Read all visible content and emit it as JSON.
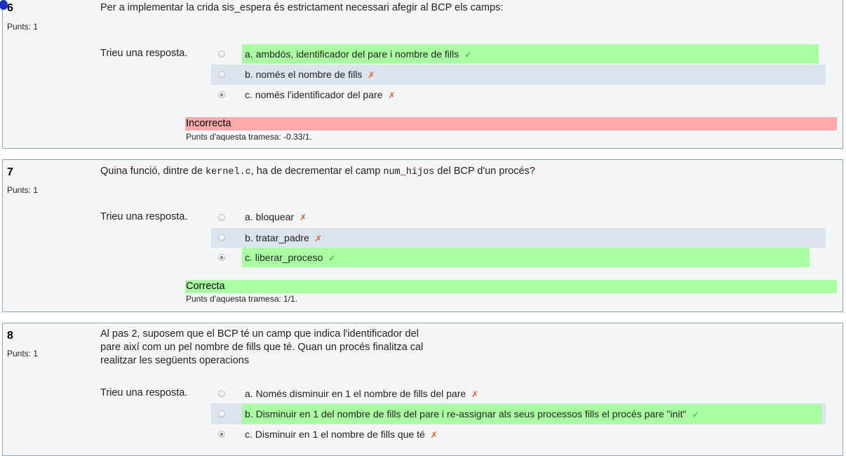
{
  "questions": [
    {
      "number": "6",
      "points": "Punts: 1",
      "text": "Per a implementar la crida sis_espera és estrictament necessari afegir al BCP els camps:",
      "prompt": "Trieu una resposta.",
      "options": [
        {
          "label": "a. ambdós, identificador del pare i nombre de fills",
          "mark": "✓"
        },
        {
          "label": "b. només el nombre de fills",
          "mark": "✗"
        },
        {
          "label": "c. només l'identificador del pare",
          "mark": "✗"
        }
      ],
      "selected": "c",
      "verdict": "Incorrecta",
      "grade": "Punts d'aquesta tramesa: -0.33/1."
    },
    {
      "number": "7",
      "points": "Punts: 1",
      "text_before": "Quina funció, dintre de ",
      "text_code1": "kernel.c",
      "text_middle": ", ha de decrementar el camp ",
      "text_code2": "num_hijos",
      "text_after": " del BCP d'un procés?",
      "prompt": "Trieu una resposta.",
      "options": [
        {
          "label": "a. bloquear",
          "mark": "✗"
        },
        {
          "label": "b. tratar_padre",
          "mark": "✗"
        },
        {
          "label": "c. liberar_proceso",
          "mark": "✓"
        }
      ],
      "selected": "c",
      "verdict": "Correcta",
      "grade": "Punts d'aquesta tramesa: 1/1."
    },
    {
      "number": "8",
      "points": "Punts: 1",
      "text_lines": [
        "Al pas 2, suposem que el BCP té un camp que indica l'identificador del",
        "pare així com un pel nombre de fills que té. Quan un procés finalitza cal",
        "realitzar les següents operacions"
      ],
      "prompt": "Trieu una resposta.",
      "options": [
        {
          "label": "a. Només disminuir en 1 el nombre de fills del pare",
          "mark": "✗"
        },
        {
          "label": "b. Disminuir en 1 del nombre de fills del pare i re-assignar als seus processos fills el procés pare \"init\"",
          "mark": "✓"
        },
        {
          "label": "c. Disminuir en 1 el nombre de fills que té",
          "mark": "✗"
        }
      ],
      "selected": "c"
    }
  ],
  "colors": {
    "correct_bg": "#aaffa3",
    "incorrect_bg": "#ffa9a9",
    "row_shade": "#dbe4ec",
    "box_border": "#8fa6c8",
    "check_mark": "#2f9a2f",
    "cross_mark": "#e55a2b"
  }
}
